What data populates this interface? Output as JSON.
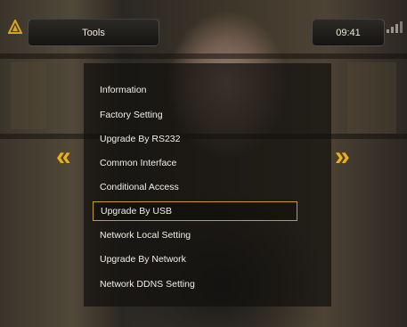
{
  "header": {
    "title": "Tools",
    "time": "09:41"
  },
  "menu": {
    "items": [
      {
        "label": "Information"
      },
      {
        "label": "Factory Setting"
      },
      {
        "label": "Upgrade By RS232"
      },
      {
        "label": "Common Interface"
      },
      {
        "label": "Conditional Access"
      },
      {
        "label": "Upgrade By USB",
        "selected": true
      },
      {
        "label": "Network Local Setting"
      },
      {
        "label": "Upgrade By Network"
      },
      {
        "label": "Network DDNS Setting"
      }
    ]
  },
  "nav": {
    "left_arrow": "«",
    "right_arrow": "»"
  },
  "colors": {
    "accent": "#e7b21f",
    "selection_border": "#c79a2d"
  },
  "icons": {
    "logo": "receiver-logo-icon",
    "signal": "signal-icon"
  }
}
